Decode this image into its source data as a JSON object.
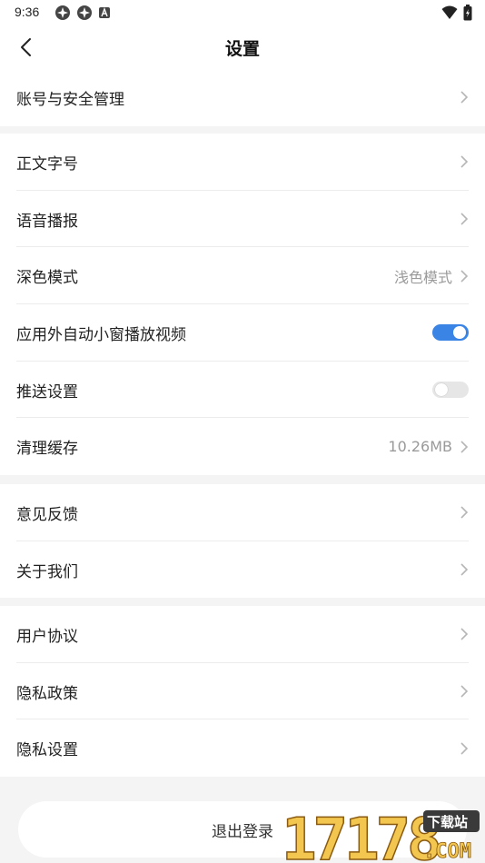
{
  "status_bar": {
    "time": "9:36"
  },
  "header": {
    "title": "设置"
  },
  "groups": [
    {
      "items": [
        {
          "label": "账号与安全管理"
        }
      ]
    },
    {
      "items": [
        {
          "label": "正文字号"
        },
        {
          "label": "语音播报"
        },
        {
          "label": "深色模式",
          "value": "浅色模式"
        },
        {
          "label": "应用外自动小窗播放视频",
          "toggle": true
        },
        {
          "label": "推送设置",
          "toggle": false
        },
        {
          "label": "清理缓存",
          "value": "10.26MB"
        }
      ]
    },
    {
      "items": [
        {
          "label": "意见反馈"
        },
        {
          "label": "关于我们"
        }
      ]
    },
    {
      "items": [
        {
          "label": "用户协议"
        },
        {
          "label": "隐私政策"
        },
        {
          "label": "隐私设置"
        }
      ]
    }
  ],
  "logout": {
    "label": "退出登录"
  },
  "watermark": {
    "text": "17178",
    "site": "下载站",
    "domain": ".COM"
  },
  "colors": {
    "accent": "#3a84e6",
    "background": "#f4f4f4"
  }
}
